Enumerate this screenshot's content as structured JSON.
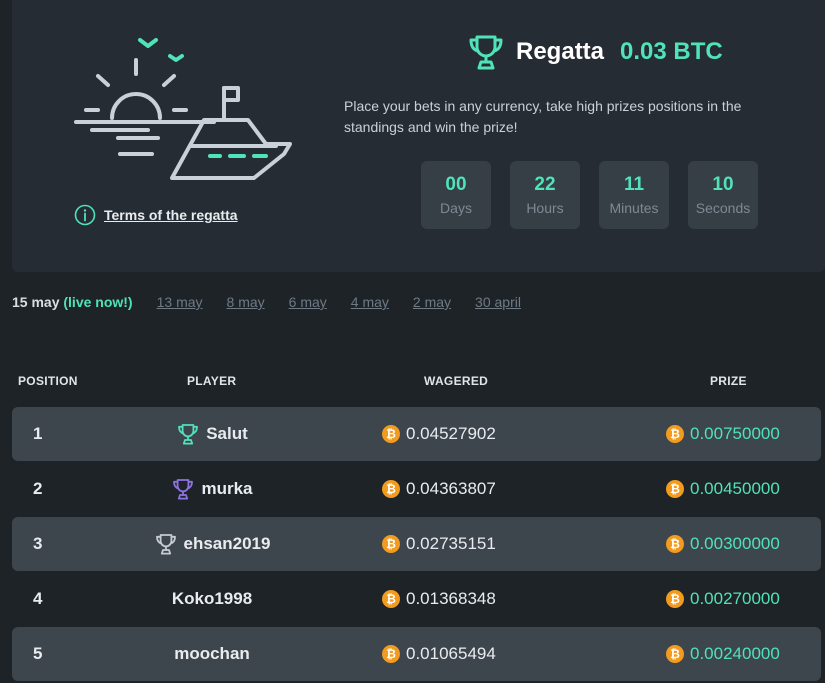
{
  "header": {
    "title": "Regatta",
    "amount": "0.03 BTC",
    "description": "Place your bets in any currency, take high prizes positions in the standings and win the prize!",
    "terms_link": "Terms of the regatta"
  },
  "timer": [
    {
      "value": "00",
      "label": "Days"
    },
    {
      "value": "22",
      "label": "Hours"
    },
    {
      "value": "11",
      "label": "Minutes"
    },
    {
      "value": "10",
      "label": "Seconds"
    }
  ],
  "dates": {
    "current": "15 may",
    "live": "(live now!)",
    "others": [
      "13 may",
      "8 may",
      "6 may",
      "4 may",
      "2 may",
      "30 april"
    ]
  },
  "table": {
    "headers": {
      "position": "POSITION",
      "player": "PLAYER",
      "wagered": "WAGERED",
      "prize": "PRIZE"
    },
    "rows": [
      {
        "position": "1",
        "player": "Salut",
        "wagered": "0.04527902",
        "prize": "0.00750000",
        "trophy": "gold-trophy-icon"
      },
      {
        "position": "2",
        "player": "murka",
        "wagered": "0.04363807",
        "prize": "0.00450000",
        "trophy": "purple-trophy-icon"
      },
      {
        "position": "3",
        "player": "ehsan2019",
        "wagered": "0.02735151",
        "prize": "0.00300000",
        "trophy": "silver-trophy-icon"
      },
      {
        "position": "4",
        "player": "Koko1998",
        "wagered": "0.01368348",
        "prize": "0.00270000",
        "trophy": ""
      },
      {
        "position": "5",
        "player": "moochan",
        "wagered": "0.01065494",
        "prize": "0.00240000",
        "trophy": ""
      }
    ],
    "coin_symbol": "₿"
  },
  "colors": {
    "accent": "#4fe3b7",
    "purple": "#8d73e0",
    "silver": "#c7ccd1",
    "btc": "#f29b1f"
  }
}
